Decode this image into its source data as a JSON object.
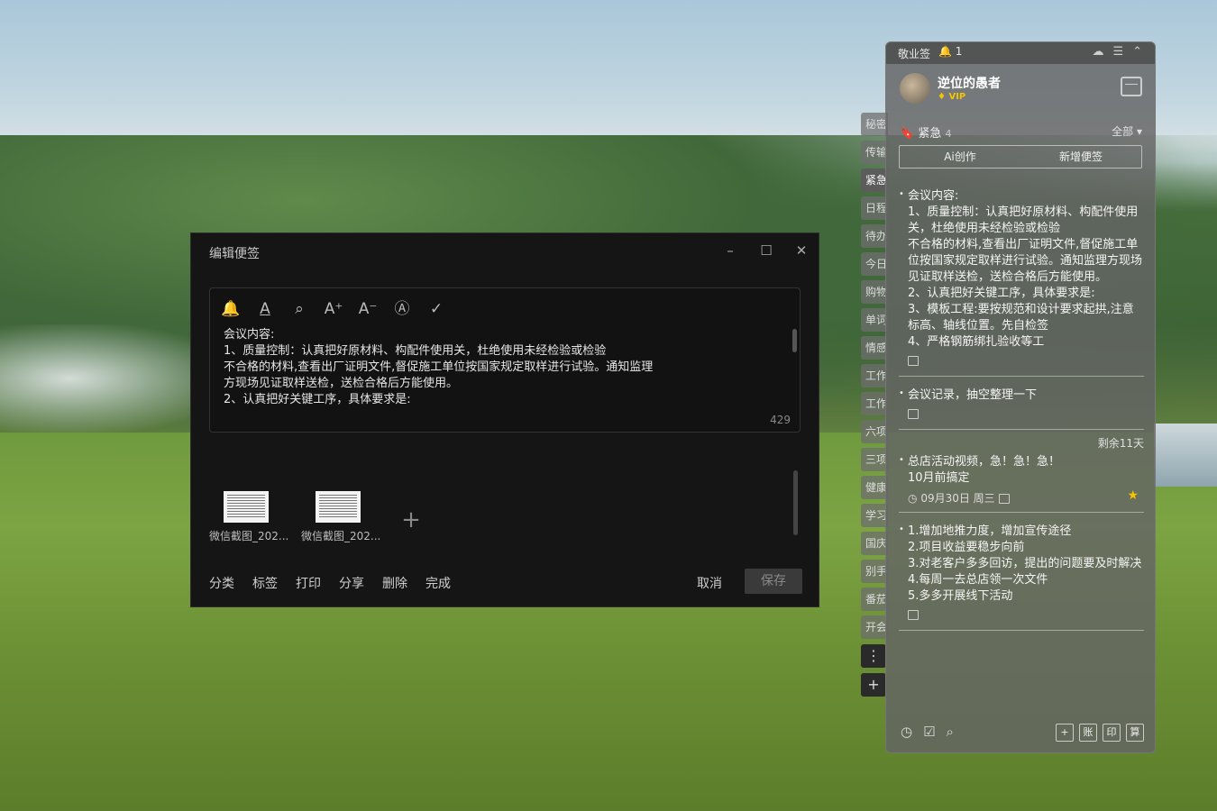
{
  "editor": {
    "title": "编辑便签",
    "win_minimize": "–",
    "win_maximize": "☐",
    "win_close": "✕",
    "toolbar": [
      "bell-icon",
      "text-color-icon",
      "search-icon",
      "font-increase-icon",
      "font-decrease-icon",
      "text-style-icon",
      "checkmark-icon"
    ],
    "toolbar_glyphs": [
      "🔔",
      "A",
      "⌕",
      "A⁺",
      "A⁻",
      "Ⓐ",
      "✓"
    ],
    "content": "会议内容:\n1、质量控制：认真把好原材料、构配件使用关，杜绝使用未经检验或检验\n不合格的材料,查看出厂证明文件,督促施工单位按国家规定取样进行试验。通知监理\n方现场见证取样送检，送检合格后方能使用。\n2、认真把好关键工序，具体要求是:",
    "char_count": "429",
    "attachments": [
      {
        "label": "微信截图_202..."
      },
      {
        "label": "微信截图_202..."
      }
    ],
    "add_glyph": "+",
    "bottom_actions": [
      "分类",
      "标签",
      "打印",
      "分享",
      "删除",
      "完成"
    ],
    "cancel": "取消",
    "save": "保存"
  },
  "tabs": {
    "items": [
      "秘密",
      "传输",
      "紧急",
      "日程",
      "待办",
      "今日",
      "购物",
      "单词",
      "情感",
      "工作",
      "工作",
      "六项",
      "三项",
      "健康",
      "学习",
      "国庆",
      "别手",
      "番茄",
      "开会"
    ],
    "active_index": 2,
    "more_glyph": "⋮",
    "add_glyph": "+"
  },
  "panel": {
    "title": "敬业签",
    "bell_count": "1",
    "user": {
      "name": "逆位的愚者",
      "vip": "VIP"
    },
    "category": {
      "name": "紧急",
      "count": "4",
      "filter": "全部"
    },
    "actions": {
      "ai": "Ai创作",
      "new": "新增便签"
    },
    "notes": [
      {
        "text": "会议内容:\n1、质量控制：认真把好原材料、构配件使用关，杜绝使用未经检验或检验\n不合格的材料,查看出厂证明文件,督促施工单位按国家规定取样进行试验。通知监理方现场见证取样送检，送检合格后方能使用。\n2、认真把好关键工序，具体要求是:\n3、模板工程:要按规范和设计要求起拱,注意标高、轴线位置。先自检签\n4、严格钢筋绑扎验收等工"
      },
      {
        "text": "会议记录，抽空整理一下"
      },
      {
        "remaining": "剩余11天",
        "text": "总店活动视频，急！急！急！\n10月前搞定",
        "date": "09月30日 周三"
      },
      {
        "text": "1.增加地推力度，增加宣传途径\n2.项目收益要稳步向前\n3.对老客户多多回访，提出的问题要及时解决\n4.每周一去总店领一次文件\n5.多多开展线下活动"
      }
    ],
    "footer_right": [
      "+",
      "账",
      "印",
      "算"
    ]
  }
}
